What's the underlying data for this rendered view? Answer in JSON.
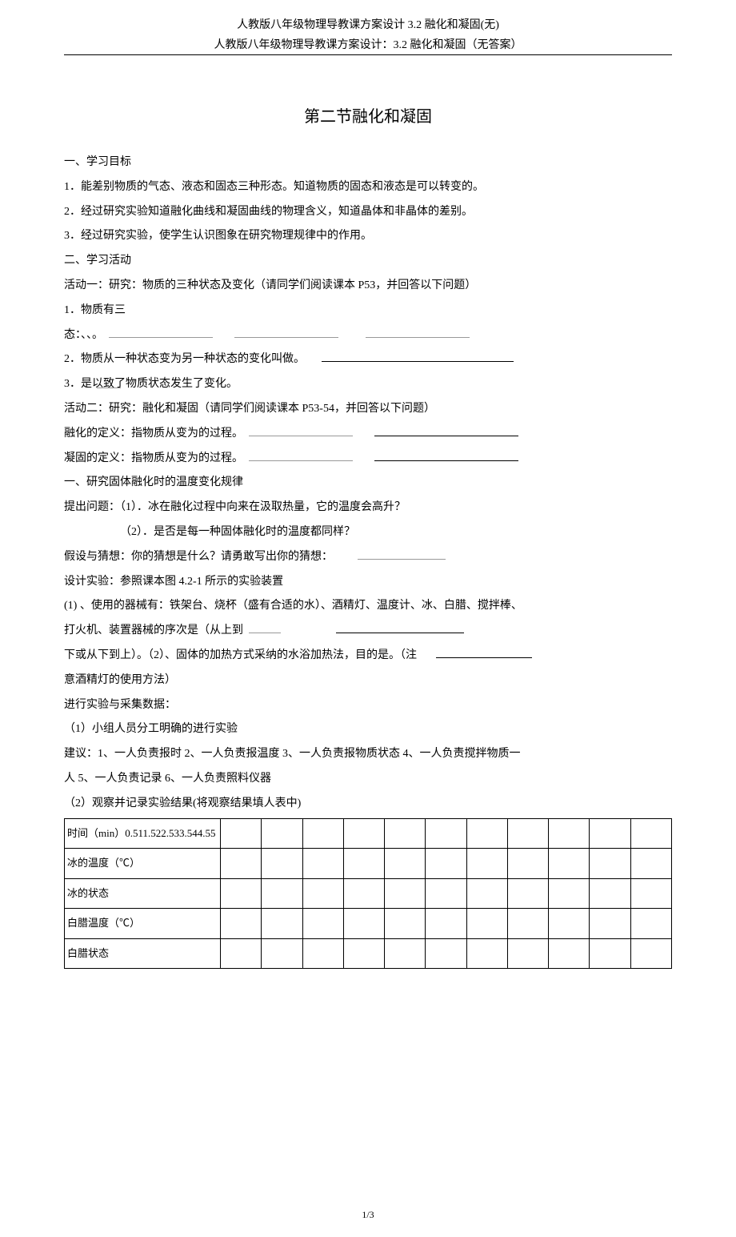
{
  "header": {
    "title": "人教版八年级物理导教课方案设计 3.2 融化和凝固(无)",
    "subtitle": "人教版八年级物理导教课方案设计：3.2 融化和凝固（无答案）"
  },
  "mainTitle": "第二节融化和凝固",
  "section1": {
    "heading": "一、学习目标",
    "item1": "1．能差别物质的气态、液态和固态三种形态。知道物质的固态和液态是可以转变的。",
    "item2": "2．经过研究实验知道融化曲线和凝固曲线的物理含义，知道晶体和非晶体的差别。",
    "item3": "3．经过研究实验，使学生认识图象在研究物理规律中的作用。"
  },
  "section2": {
    "heading": "二、学习活动",
    "activity1": {
      "title": "活动一：研究：物质的三种状态及变化（请同学们阅读课本 P53，并回答以下问题）",
      "q1a": "1．物质有三",
      "q1b": "态：、、。",
      "q2": "2．物质从一种状态变为另一种状态的变化叫做。",
      "q3": "3．是以致了物质状态发生了变化。"
    },
    "activity2": {
      "title": "活动二：研究：融化和凝固（请同学们阅读课本 P53-54，并回答以下问题）",
      "def1": "融化的定义：指物质从变为的过程。",
      "def2": "凝固的定义：指物质从变为的过程。",
      "sub1": "一、研究固体融化时的温度变化规律",
      "question1": "提出问题：（1）．冰在融化过程中向来在汲取热量，它的温度会高升？",
      "question2": "（2）．是否是每一种固体融化时的温度都同样？",
      "hypothesis": "假设与猜想：你的猜想是什么？请勇敢写出你的猜想：",
      "design": "设计实验：参照课本图 4.2-1 所示的实验装置",
      "equip1": "(1) 、使用的器械有：铁架台、烧杯（盛有合适的水）、酒精灯、温度计、冰、白腊、搅拌棒、",
      "equip2": "打火机、装置器械的序次是（从上到",
      "equip3": "下或从下到上）。（2）、固体的加热方式采纳的水浴加热法，目的是。（注",
      "equip4": "意酒精灯的使用方法）",
      "collect": "进行实验与采集数据：",
      "step1": "（1）小组人员分工明确的进行实验",
      "suggest1": "建议：1、一人负责报时 2、一人负责报温度 3、一人负责报物质状态 4、一人负责搅拌物质一",
      "suggest2": "人 5、一人负责记录 6、一人负责照料仪器",
      "step2": "（2）观察并记录实验结果(将观察结果填人表中)"
    }
  },
  "table": {
    "row1": "时间（min）0.511.522.533.544.55",
    "row2": "冰的温度（℃）",
    "row3": "冰的状态",
    "row4": "白腊温度（℃）",
    "row5": "白腊状态"
  },
  "footer": {
    "pageNum": "1/3"
  }
}
